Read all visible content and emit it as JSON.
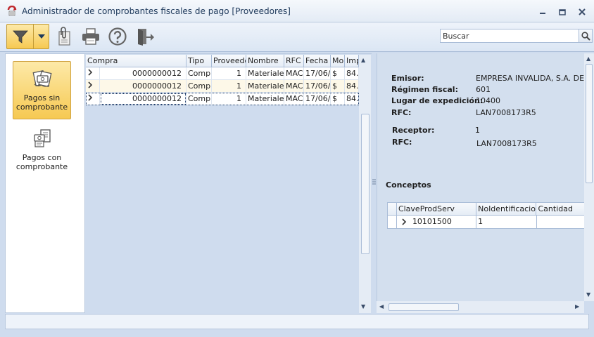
{
  "window": {
    "title": "Administrador de comprobantes fiscales de pago [Proveedores]",
    "buttons": [
      "minimize-icon",
      "restore-icon",
      "close-icon"
    ]
  },
  "toolbar": {
    "filter_icon": "filter-icon",
    "dropdown_icon": "chevron-down-icon",
    "tools": [
      "attach-document-icon",
      "print-icon",
      "help-icon",
      "exit-icon"
    ],
    "search": {
      "placeholder": "Buscar",
      "value": "Buscar"
    }
  },
  "nav": {
    "items": [
      {
        "label_1": "Pagos sin",
        "label_2": "comprobante",
        "icon": "payment-money-icon",
        "active": true
      },
      {
        "label_1": "Pagos con",
        "label_2": "comprobante",
        "icon": "payment-receipt-icon",
        "active": false
      }
    ]
  },
  "grid": {
    "columns": [
      "Compra",
      "Tipo",
      "Proveedo",
      "Nombre",
      "RFC",
      "Fecha",
      "Mo",
      "Imp"
    ],
    "rows": [
      [
        "0000000012",
        "Compr",
        "1",
        "Materiales",
        "MAC",
        "17/06/",
        "$",
        "84."
      ],
      [
        "0000000012",
        "Compr",
        "1",
        "Materiales",
        "MAC",
        "17/06/",
        "$",
        "84."
      ],
      [
        "0000000012",
        "Compr",
        "1",
        "Materiales",
        "MAC",
        "17/06/",
        "$",
        "84."
      ]
    ]
  },
  "detail": {
    "emisor_label": "Emisor:",
    "emisor_value": "EMPRESA INVALIDA, S.A. DE C",
    "regimen_label": "Régimen fiscal:",
    "regimen_value": "601",
    "lugar_label": "Lugar de expedición:",
    "lugar_value": "10400",
    "rfc1_label": "RFC:",
    "rfc1_value": "LAN7008173R5",
    "receptor_label": "Receptor:",
    "receptor_value": "1",
    "rfc2_label": "RFC:",
    "rfc2_value": "LAN7008173R5",
    "conceptos_label": "Conceptos",
    "conceptos": {
      "columns": [
        "ClaveProdServ",
        "NoIdentificacion",
        "Cantidad"
      ],
      "rows": [
        [
          "10101500",
          "1",
          ""
        ]
      ]
    }
  },
  "colors": {
    "accent": "#f6c952",
    "panel_bg": "#cfdcee",
    "title_text": "#1e395b"
  }
}
